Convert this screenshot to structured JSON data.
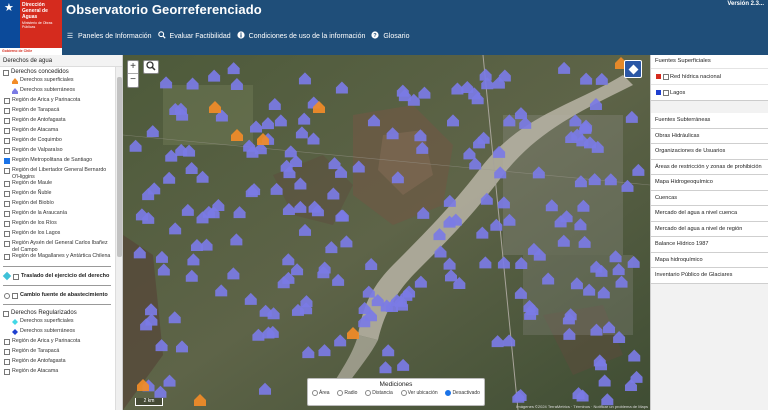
{
  "header": {
    "logo": {
      "org": "Dirección General de Aguas",
      "ministry": "Ministerio de Obras Públicas",
      "gov": "Gobierno de Chile"
    },
    "title": "Observatorio Georreferenciado",
    "version": "Versión 2.3...",
    "nav": [
      {
        "label": "Paneles de Información",
        "icon": "menu-icon"
      },
      {
        "label": "Evaluar Factibilidad",
        "icon": "search-icon"
      },
      {
        "label": "Condiciones de uso de la información",
        "icon": "info-icon"
      },
      {
        "label": "Glosario",
        "icon": "help-icon"
      }
    ]
  },
  "left_panel": {
    "title": "Derechos de agua",
    "concedidos": {
      "label": "Derechos concedidos",
      "subs": [
        "Derechos superficiales",
        "Derechos subterráneos"
      ],
      "regions": [
        {
          "label": "Región de Arica y Parinacota",
          "checked": false
        },
        {
          "label": "Región de Tarapacá",
          "checked": false
        },
        {
          "label": "Región de Antofagasta",
          "checked": false
        },
        {
          "label": "Región de Atacama",
          "checked": false
        },
        {
          "label": "Región de Coquimbo",
          "checked": false
        },
        {
          "label": "Región de Valparaíso",
          "checked": false
        },
        {
          "label": "Región Metropolitana de Santiago",
          "checked": true
        },
        {
          "label": "Región del Libertador General Bernardo O'Higgins",
          "checked": false
        },
        {
          "label": "Región de Maule",
          "checked": false
        },
        {
          "label": "Región de Ñuble",
          "checked": false
        },
        {
          "label": "Región del Biobío",
          "checked": false
        },
        {
          "label": "Región de la Araucanía",
          "checked": false
        },
        {
          "label": "Región de los Ríos",
          "checked": false
        },
        {
          "label": "Región de los Lagos",
          "checked": false
        },
        {
          "label": "Región Aysén del General Carlos Ibañez del Campo",
          "checked": false
        },
        {
          "label": "Región de Magallanes y Antártica Chilena",
          "checked": false
        }
      ]
    },
    "traslado": "Traslado del ejercicio del derecho",
    "cambio": "Cambio fuente de abastecimiento",
    "regularizados": {
      "label": "Derechos Regularizados",
      "subs": [
        "Derechos superficiales",
        "Derechos subterráneos"
      ],
      "regions": [
        {
          "label": "Región de Arica y Parinacota",
          "checked": false
        },
        {
          "label": "Región de Tarapacá",
          "checked": false
        },
        {
          "label": "Región de Antofagasta",
          "checked": false
        },
        {
          "label": "Región de Atacama",
          "checked": false
        }
      ]
    }
  },
  "map": {
    "zoom_in": "+",
    "zoom_out": "−",
    "scale": "2 km",
    "attribution": "Imágenes ©2024 TerraMetrics · Términos · Notificar un problema de Maps",
    "measure": {
      "title": "Mediciones",
      "options": [
        "Área",
        "Radio",
        "Distancia",
        "Ver ubicación",
        "Desactivado"
      ]
    },
    "colors": {
      "purple": "#7b7be5",
      "orange": "#f28c28"
    }
  },
  "right_panel": {
    "superficiales": {
      "title": "Fuentes Superficiales",
      "layers": [
        {
          "label": "Red hídrica nacional",
          "color": "#d52b1e"
        },
        {
          "label": "Lagos",
          "color": "#1e3fcf"
        }
      ]
    },
    "items": [
      "Fuentes Subterráneas",
      "Obras Hidráulicas",
      "Organizaciones de Usuarios",
      "Áreas de restricción y zonas de prohibición",
      "Mapa Hidrogeoquímico",
      "Cuencas",
      "Mercado del agua a nivel cuenca",
      "Mercado del agua a nivel de región",
      "Balance Hídrico 1987",
      "Mapa hidroquímico",
      "Inventario Público de Glaciares"
    ]
  }
}
